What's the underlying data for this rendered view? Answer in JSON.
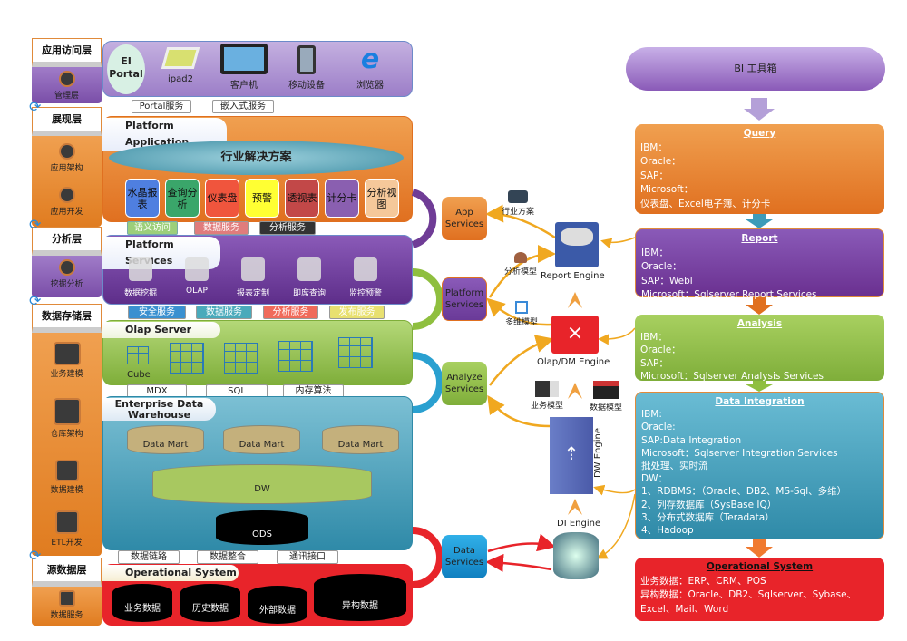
{
  "layers": [
    {
      "title": "应用访问层",
      "roles": [
        "管理层"
      ]
    },
    {
      "title": "展现层",
      "roles": [
        "应用架构",
        "应用开发"
      ]
    },
    {
      "title": "分析层",
      "roles": [
        "挖掘分析"
      ]
    },
    {
      "title": "数据存储层",
      "roles": [
        "业务建模",
        "仓库架构",
        "数据建模",
        "ETL开发"
      ]
    },
    {
      "title": "源数据层",
      "roles": [
        "数据服务"
      ]
    }
  ],
  "access": {
    "portal": "EI Portal",
    "devices": [
      "ipad2",
      "客户机",
      "移动设备",
      "浏览器"
    ],
    "tags": [
      "Portal服务",
      "嵌入式服务"
    ]
  },
  "platform_app": {
    "title": "Platform Application",
    "banner": "行业解决方案",
    "tiles": [
      {
        "label": "水晶报表",
        "color": "#4f7fe0"
      },
      {
        "label": "查询分析",
        "color": "#3aa66a"
      },
      {
        "label": "仪表盘",
        "color": "#f0553d"
      },
      {
        "label": "预警",
        "color": "#ffff33"
      },
      {
        "label": "透视表",
        "color": "#c24848"
      },
      {
        "label": "计分卡",
        "color": "#8a5fb0"
      },
      {
        "label": "分析视图",
        "color": "#f5c89a"
      }
    ],
    "tags": [
      "语义访问",
      "数据服务",
      "分析服务"
    ]
  },
  "platform_services": {
    "title": "Platform Services",
    "items": [
      "数据挖掘",
      "OLAP",
      "报表定制",
      "即席查询",
      "监控预警"
    ],
    "tags": [
      "安全服务",
      "数据服务",
      "分析服务",
      "发布服务"
    ]
  },
  "olap": {
    "title": "Olap Server",
    "cube_label": "Cube",
    "tags": [
      "MDX",
      "SQL",
      "内存算法"
    ]
  },
  "edw": {
    "title": "Enterprise Data Warehouse",
    "marts": [
      "Data Mart",
      "Data Mart",
      "Data Mart"
    ],
    "dw": "DW",
    "ods": "ODS",
    "tags": [
      "数据链路",
      "数据整合",
      "通讯接口"
    ]
  },
  "ops": {
    "title": "Operational System",
    "items": [
      "业务数据",
      "历史数据",
      "外部数据",
      "异构数据"
    ]
  },
  "services": [
    "App Services",
    "Platform Services",
    "Analyze Services",
    "Data Services"
  ],
  "engines": {
    "report": "Report Engine",
    "olap": "Olap/DM  Engine",
    "dw": "DW Engine",
    "di": "DI  Engine"
  },
  "models": [
    "行业方案",
    "分析模型",
    "多维模型",
    "业务模型",
    "数据模型"
  ],
  "toolbox": {
    "title": "BI 工具箱",
    "boxes": [
      {
        "title": "Query",
        "lines": [
          "IBM：",
          "Oracle：",
          "SAP：",
          "Microsoft：",
          "仪表盘、Excel电子簿、计分卡"
        ]
      },
      {
        "title": "Report",
        "lines": [
          "IBM：",
          "Oracle：",
          "SAP：Webl",
          "Microsoft：Sqlserver  Report  Services"
        ]
      },
      {
        "title": "Analysis",
        "lines": [
          "IBM：",
          "Oracle：",
          "SAP：",
          "Microsoft：Sqlserver  Analysis  Services"
        ]
      },
      {
        "title": "Data  Integration",
        "lines": [
          "IBM:",
          "Oracle:",
          "SAP:Data Integration",
          "Microsoft：Sqlserver  Integration  Services",
          "批处理、实时流",
          "DW：",
          "1、RDBMS：（Oracle、DB2、MS-Sql、多维）",
          "2、列存数据库（SysBase  IQ）",
          "3、分布式数据库（Teradata）",
          "4、Hadoop"
        ]
      },
      {
        "title": "Operational System",
        "lines": [
          "业务数据：ERP、CRM、POS",
          "异构数据：Oracle、DB2、Sqlserver、Sybase、",
          "Excel、Mail、Word"
        ]
      }
    ]
  },
  "colors": {
    "orange": "#e98a2e",
    "purple": "#6f3c96",
    "green": "#8fbf3f",
    "teal": "#3d9bb8",
    "red": "#e8242a"
  }
}
